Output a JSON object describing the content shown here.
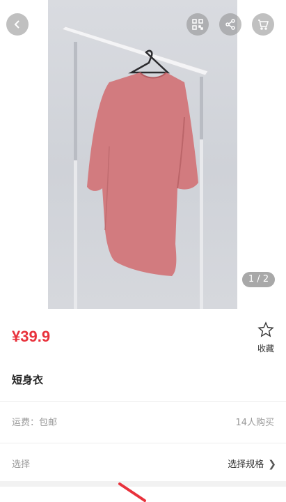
{
  "header": {
    "back_icon": "chevron-left-icon",
    "qr_icon": "qr-code-icon",
    "share_icon": "share-icon",
    "cart_icon": "cart-icon"
  },
  "gallery": {
    "pager": "1 / 2",
    "current": 1,
    "total": 2
  },
  "product": {
    "price": "¥39.9",
    "title": "短身衣",
    "favorite_label": "收藏"
  },
  "shipping": {
    "label": "运费：包邮",
    "purchases": "14人购买"
  },
  "spec": {
    "label": "选择",
    "action": "选择规格"
  },
  "colors": {
    "price": "#e8323c",
    "shirt": "#d27b7f",
    "muted_text": "#999999"
  }
}
